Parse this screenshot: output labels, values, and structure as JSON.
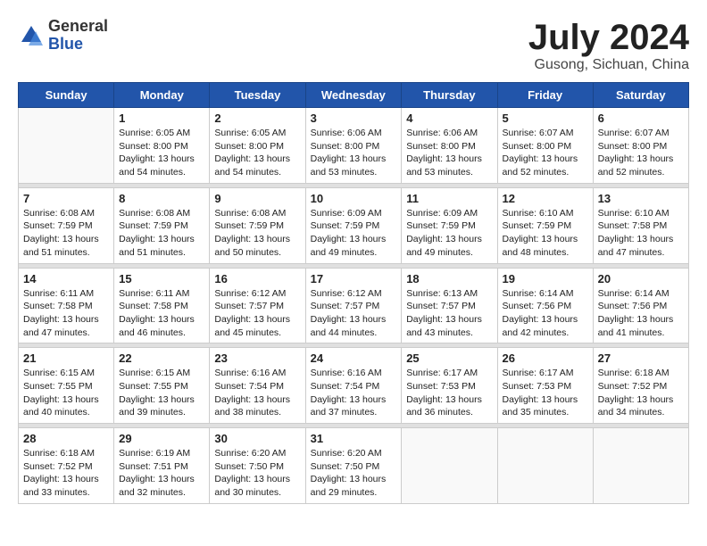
{
  "header": {
    "logo": {
      "general": "General",
      "blue": "Blue"
    },
    "title": "July 2024",
    "location": "Gusong, Sichuan, China"
  },
  "weekdays": [
    "Sunday",
    "Monday",
    "Tuesday",
    "Wednesday",
    "Thursday",
    "Friday",
    "Saturday"
  ],
  "weeks": [
    [
      {
        "day": "",
        "info": ""
      },
      {
        "day": "1",
        "info": "Sunrise: 6:05 AM\nSunset: 8:00 PM\nDaylight: 13 hours\nand 54 minutes."
      },
      {
        "day": "2",
        "info": "Sunrise: 6:05 AM\nSunset: 8:00 PM\nDaylight: 13 hours\nand 54 minutes."
      },
      {
        "day": "3",
        "info": "Sunrise: 6:06 AM\nSunset: 8:00 PM\nDaylight: 13 hours\nand 53 minutes."
      },
      {
        "day": "4",
        "info": "Sunrise: 6:06 AM\nSunset: 8:00 PM\nDaylight: 13 hours\nand 53 minutes."
      },
      {
        "day": "5",
        "info": "Sunrise: 6:07 AM\nSunset: 8:00 PM\nDaylight: 13 hours\nand 52 minutes."
      },
      {
        "day": "6",
        "info": "Sunrise: 6:07 AM\nSunset: 8:00 PM\nDaylight: 13 hours\nand 52 minutes."
      }
    ],
    [
      {
        "day": "7",
        "info": "Sunrise: 6:08 AM\nSunset: 7:59 PM\nDaylight: 13 hours\nand 51 minutes."
      },
      {
        "day": "8",
        "info": "Sunrise: 6:08 AM\nSunset: 7:59 PM\nDaylight: 13 hours\nand 51 minutes."
      },
      {
        "day": "9",
        "info": "Sunrise: 6:08 AM\nSunset: 7:59 PM\nDaylight: 13 hours\nand 50 minutes."
      },
      {
        "day": "10",
        "info": "Sunrise: 6:09 AM\nSunset: 7:59 PM\nDaylight: 13 hours\nand 49 minutes."
      },
      {
        "day": "11",
        "info": "Sunrise: 6:09 AM\nSunset: 7:59 PM\nDaylight: 13 hours\nand 49 minutes."
      },
      {
        "day": "12",
        "info": "Sunrise: 6:10 AM\nSunset: 7:59 PM\nDaylight: 13 hours\nand 48 minutes."
      },
      {
        "day": "13",
        "info": "Sunrise: 6:10 AM\nSunset: 7:58 PM\nDaylight: 13 hours\nand 47 minutes."
      }
    ],
    [
      {
        "day": "14",
        "info": "Sunrise: 6:11 AM\nSunset: 7:58 PM\nDaylight: 13 hours\nand 47 minutes."
      },
      {
        "day": "15",
        "info": "Sunrise: 6:11 AM\nSunset: 7:58 PM\nDaylight: 13 hours\nand 46 minutes."
      },
      {
        "day": "16",
        "info": "Sunrise: 6:12 AM\nSunset: 7:57 PM\nDaylight: 13 hours\nand 45 minutes."
      },
      {
        "day": "17",
        "info": "Sunrise: 6:12 AM\nSunset: 7:57 PM\nDaylight: 13 hours\nand 44 minutes."
      },
      {
        "day": "18",
        "info": "Sunrise: 6:13 AM\nSunset: 7:57 PM\nDaylight: 13 hours\nand 43 minutes."
      },
      {
        "day": "19",
        "info": "Sunrise: 6:14 AM\nSunset: 7:56 PM\nDaylight: 13 hours\nand 42 minutes."
      },
      {
        "day": "20",
        "info": "Sunrise: 6:14 AM\nSunset: 7:56 PM\nDaylight: 13 hours\nand 41 minutes."
      }
    ],
    [
      {
        "day": "21",
        "info": "Sunrise: 6:15 AM\nSunset: 7:55 PM\nDaylight: 13 hours\nand 40 minutes."
      },
      {
        "day": "22",
        "info": "Sunrise: 6:15 AM\nSunset: 7:55 PM\nDaylight: 13 hours\nand 39 minutes."
      },
      {
        "day": "23",
        "info": "Sunrise: 6:16 AM\nSunset: 7:54 PM\nDaylight: 13 hours\nand 38 minutes."
      },
      {
        "day": "24",
        "info": "Sunrise: 6:16 AM\nSunset: 7:54 PM\nDaylight: 13 hours\nand 37 minutes."
      },
      {
        "day": "25",
        "info": "Sunrise: 6:17 AM\nSunset: 7:53 PM\nDaylight: 13 hours\nand 36 minutes."
      },
      {
        "day": "26",
        "info": "Sunrise: 6:17 AM\nSunset: 7:53 PM\nDaylight: 13 hours\nand 35 minutes."
      },
      {
        "day": "27",
        "info": "Sunrise: 6:18 AM\nSunset: 7:52 PM\nDaylight: 13 hours\nand 34 minutes."
      }
    ],
    [
      {
        "day": "28",
        "info": "Sunrise: 6:18 AM\nSunset: 7:52 PM\nDaylight: 13 hours\nand 33 minutes."
      },
      {
        "day": "29",
        "info": "Sunrise: 6:19 AM\nSunset: 7:51 PM\nDaylight: 13 hours\nand 32 minutes."
      },
      {
        "day": "30",
        "info": "Sunrise: 6:20 AM\nSunset: 7:50 PM\nDaylight: 13 hours\nand 30 minutes."
      },
      {
        "day": "31",
        "info": "Sunrise: 6:20 AM\nSunset: 7:50 PM\nDaylight: 13 hours\nand 29 minutes."
      },
      {
        "day": "",
        "info": ""
      },
      {
        "day": "",
        "info": ""
      },
      {
        "day": "",
        "info": ""
      }
    ]
  ]
}
